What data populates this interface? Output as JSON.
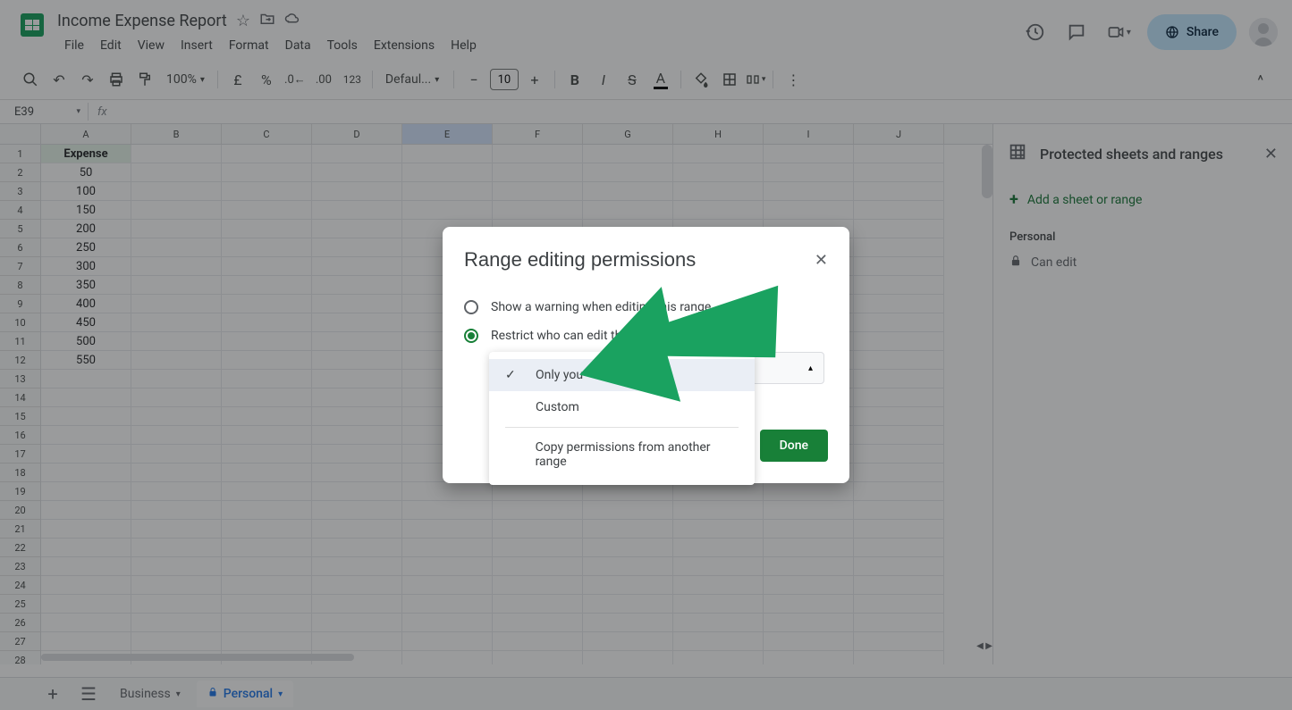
{
  "doc": {
    "title": "Income Expense Report"
  },
  "menu": {
    "file": "File",
    "edit": "Edit",
    "view": "View",
    "insert": "Insert",
    "format": "Format",
    "data": "Data",
    "tools": "Tools",
    "extensions": "Extensions",
    "help": "Help"
  },
  "header": {
    "share": "Share"
  },
  "toolbar": {
    "zoom": "100%",
    "currency": "£",
    "percent": "%",
    "num_fmt": "123",
    "font": "Defaul...",
    "font_size": "10"
  },
  "namebox": {
    "ref": "E39"
  },
  "columns": [
    "A",
    "B",
    "C",
    "D",
    "E",
    "F",
    "G",
    "H",
    "I",
    "J"
  ],
  "selected_col": "E",
  "rows": [
    {
      "n": 1,
      "a": "Expense",
      "header": true
    },
    {
      "n": 2,
      "a": "50"
    },
    {
      "n": 3,
      "a": "100"
    },
    {
      "n": 4,
      "a": "150"
    },
    {
      "n": 5,
      "a": "200"
    },
    {
      "n": 6,
      "a": "250"
    },
    {
      "n": 7,
      "a": "300"
    },
    {
      "n": 8,
      "a": "350"
    },
    {
      "n": 9,
      "a": "400"
    },
    {
      "n": 10,
      "a": "450"
    },
    {
      "n": 11,
      "a": "500"
    },
    {
      "n": 12,
      "a": "550"
    }
  ],
  "empty_row_count": 17,
  "side_panel": {
    "title": "Protected sheets and ranges",
    "add": "Add a sheet or range",
    "section": "Personal",
    "item": "Can edit"
  },
  "sheet_tabs": {
    "business": "Business",
    "personal": "Personal"
  },
  "modal": {
    "title": "Range editing permissions",
    "opt_warning": "Show a warning when editing this range",
    "opt_restrict": "Restrict who can edit this range",
    "dd_only_you": "Only you",
    "dd_custom": "Custom",
    "dd_copy": "Copy permissions from another range",
    "done": "Done"
  }
}
